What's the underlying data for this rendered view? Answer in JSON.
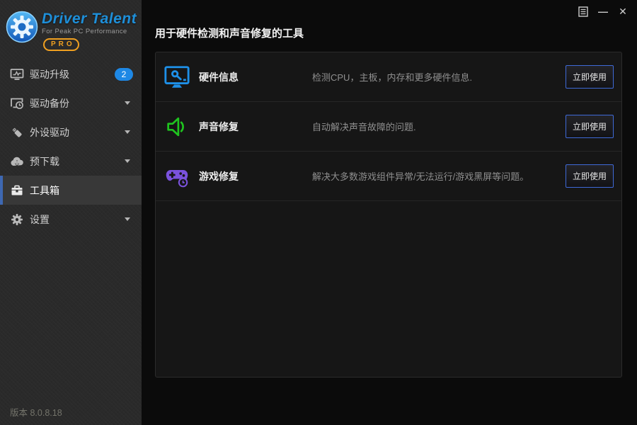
{
  "window": {
    "minimize_glyph": "—",
    "close_glyph": "✕"
  },
  "sidebar": {
    "logo": {
      "title": "Driver Talent",
      "subtitle": "For Peak PC Performance",
      "badge": "PRO"
    },
    "items": [
      {
        "label": "驱动升级",
        "icon": "monitor-pulse-icon",
        "badge": "2"
      },
      {
        "label": "驱动备份",
        "icon": "monitor-clock-icon",
        "chevron": true
      },
      {
        "label": "外设驱动",
        "icon": "usb-drive-icon",
        "chevron": true
      },
      {
        "label": "预下载",
        "icon": "cloud-download-icon",
        "chevron": true
      },
      {
        "label": "工具箱",
        "icon": "toolbox-icon",
        "selected": true
      },
      {
        "label": "设置",
        "icon": "gear-icon",
        "chevron": true
      }
    ],
    "version": "版本 8.0.8.18"
  },
  "main": {
    "title": "用于硬件检测和声音修复的工具",
    "tools": [
      {
        "name": "硬件信息",
        "icon": "hardware-info-icon",
        "description": "检测CPU，主板，内存和更多硬件信息.",
        "action": "立即使用"
      },
      {
        "name": "声音修复",
        "icon": "sound-repair-icon",
        "description": "自动解决声音故障的问题.",
        "action": "立即使用"
      },
      {
        "name": "游戏修复",
        "icon": "game-repair-icon",
        "description": "解决大多数游戏组件异常/无法运行/游戏黑屏等问题。",
        "action": "立即使用"
      }
    ]
  },
  "colors": {
    "accent_blue": "#1e88e5",
    "tool_blue": "#1e90e8",
    "tool_green": "#1fc41f",
    "tool_purple": "#7a52dd",
    "pro_orange": "#f0a020",
    "selected_bar_blue": "#3e68b2",
    "button_border_blue": "#3f6ad8"
  }
}
